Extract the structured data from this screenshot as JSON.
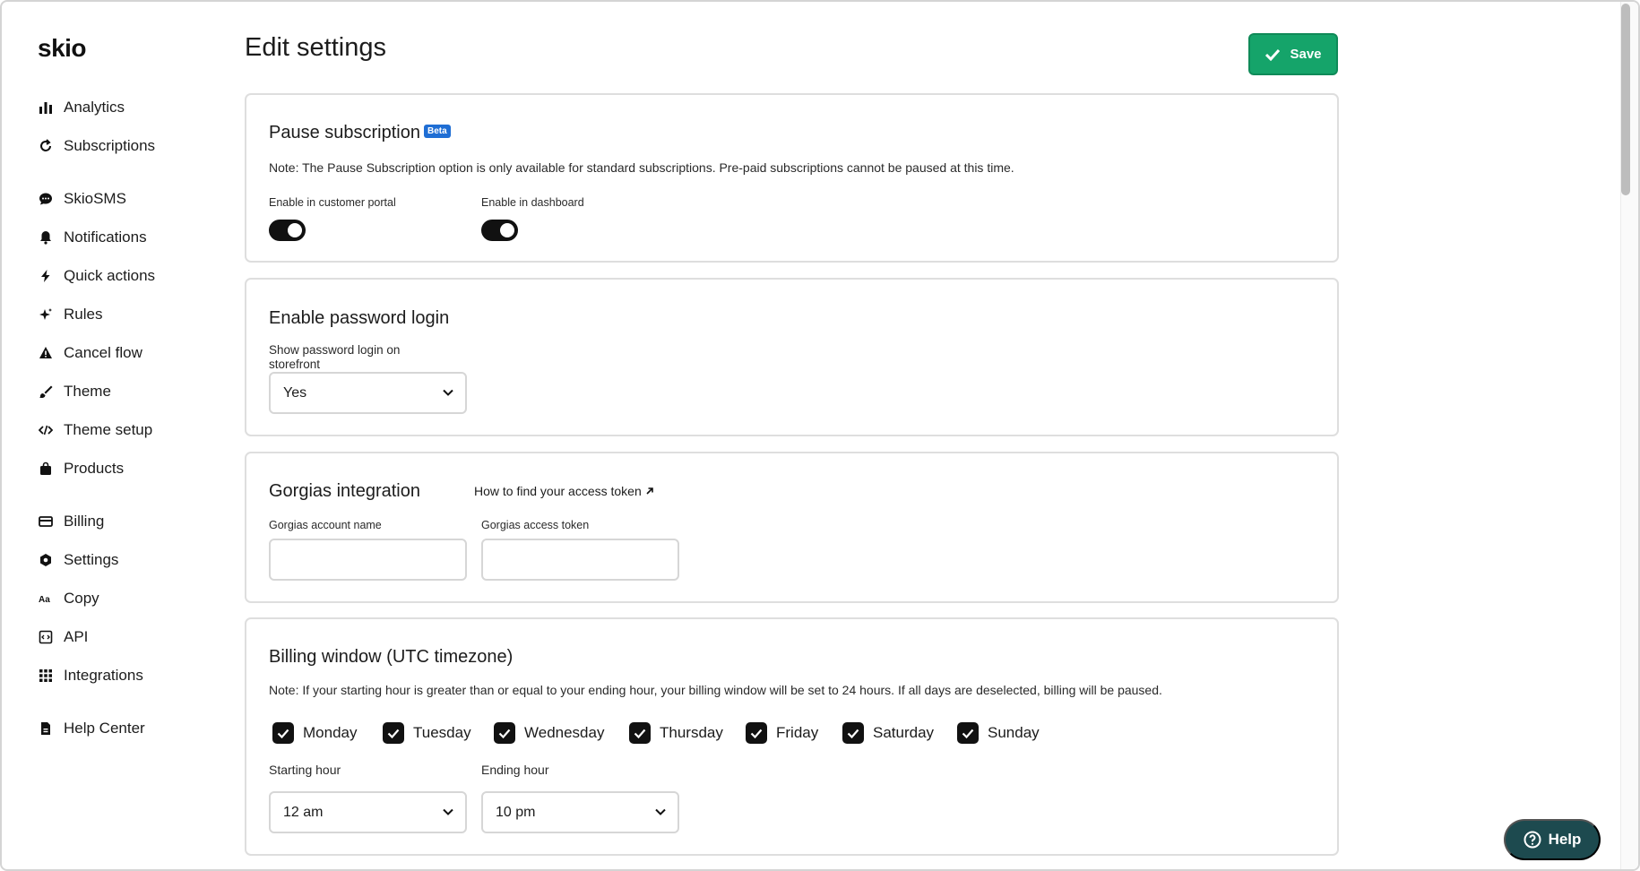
{
  "app": {
    "logo": "skio"
  },
  "sidebar": {
    "items": [
      {
        "label": "Analytics",
        "icon": "bar-chart-icon"
      },
      {
        "label": "Subscriptions",
        "icon": "refresh-icon"
      },
      {
        "label": "SkioSMS",
        "icon": "chat-bubble-icon"
      },
      {
        "label": "Notifications",
        "icon": "bell-icon"
      },
      {
        "label": "Quick actions",
        "icon": "lightning-icon"
      },
      {
        "label": "Rules",
        "icon": "sparkle-icon"
      },
      {
        "label": "Cancel flow",
        "icon": "warning-triangle-icon"
      },
      {
        "label": "Theme",
        "icon": "brush-icon"
      },
      {
        "label": "Theme setup",
        "icon": "code-icon"
      },
      {
        "label": "Products",
        "icon": "shopping-bag-icon"
      },
      {
        "label": "Billing",
        "icon": "credit-card-icon"
      },
      {
        "label": "Settings",
        "icon": "gear-icon"
      },
      {
        "label": "Copy",
        "icon": "text-aa-icon"
      },
      {
        "label": "API",
        "icon": "api-icon"
      },
      {
        "label": "Integrations",
        "icon": "grid-icon"
      },
      {
        "label": "Help Center",
        "icon": "document-icon"
      }
    ]
  },
  "header": {
    "title": "Edit settings",
    "save_label": "Save"
  },
  "pause": {
    "title": "Pause subscription",
    "badge": "Beta",
    "note": "Note: The Pause Subscription option is only available for standard subscriptions. Pre-paid subscriptions cannot be paused at this time.",
    "portal_label": "Enable in customer portal",
    "portal_enabled": true,
    "dashboard_label": "Enable in dashboard",
    "dashboard_enabled": true
  },
  "password": {
    "title": "Enable password login",
    "field_label": "Show password login on storefront",
    "value": "Yes"
  },
  "gorgias": {
    "title": "Gorgias integration",
    "help_link": "How to find your access token",
    "account_label": "Gorgias account name",
    "account_value": "",
    "token_label": "Gorgias access token",
    "token_value": ""
  },
  "billing": {
    "title": "Billing window (UTC timezone)",
    "note": "Note: If your starting hour is greater than or equal to your ending hour, your billing window will be set to 24 hours. If all days are deselected, billing will be paused.",
    "days": [
      {
        "label": "Monday",
        "checked": true
      },
      {
        "label": "Tuesday",
        "checked": true
      },
      {
        "label": "Wednesday",
        "checked": true
      },
      {
        "label": "Thursday",
        "checked": true
      },
      {
        "label": "Friday",
        "checked": true
      },
      {
        "label": "Saturday",
        "checked": true
      },
      {
        "label": "Sunday",
        "checked": true
      }
    ],
    "start_label": "Starting hour",
    "start_value": "12 am",
    "end_label": "Ending hour",
    "end_value": "10 pm"
  },
  "help_widget": {
    "label": "Help",
    "icon": "question-circle-icon"
  },
  "colors": {
    "accent": "#15a46a",
    "toggle_on": "#111111",
    "help_bg": "#1d4a4f",
    "beta": "#1f6ed4"
  }
}
